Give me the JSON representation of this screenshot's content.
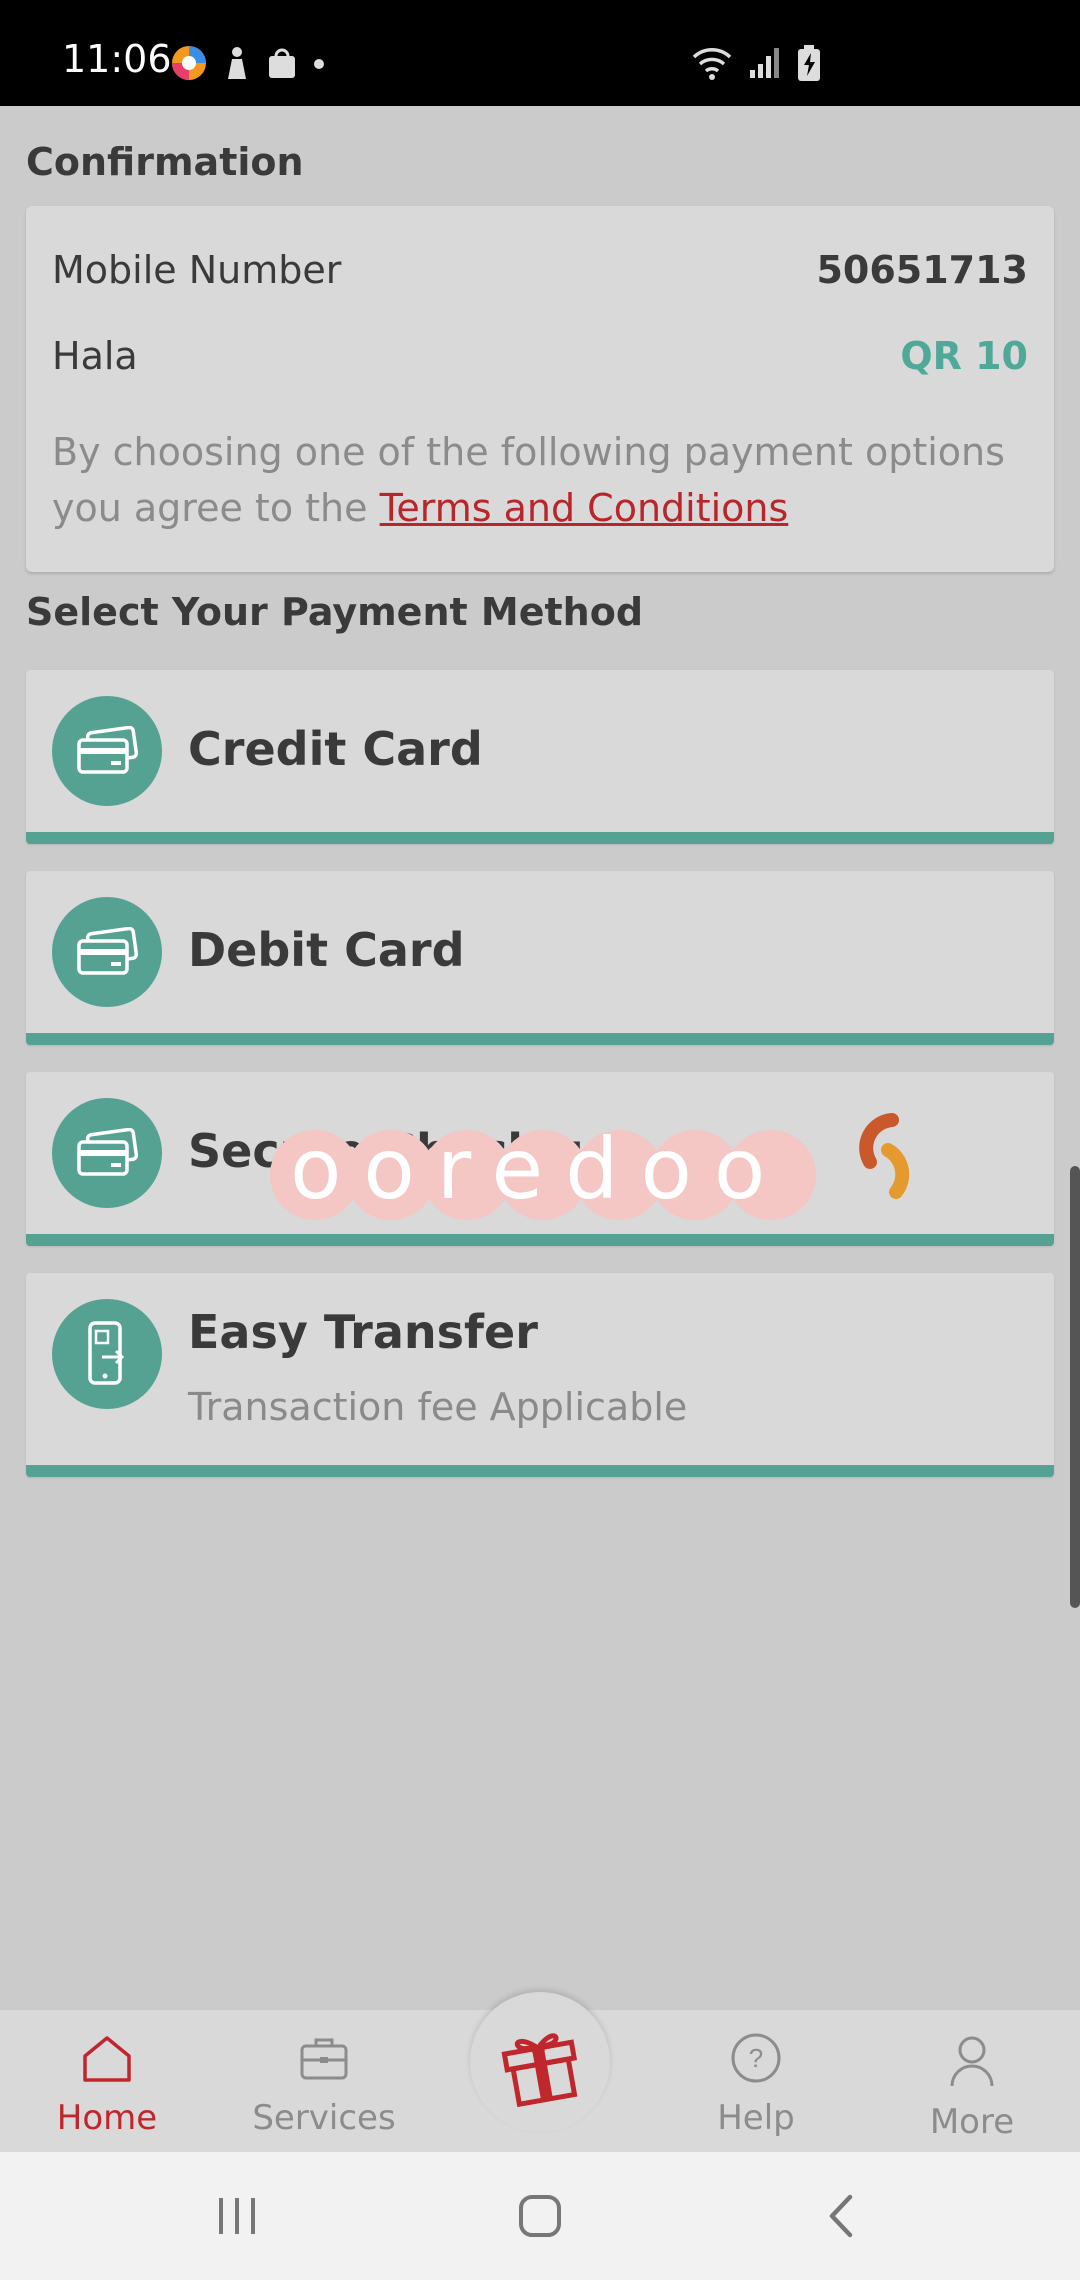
{
  "status_bar": {
    "time": "11:06",
    "icons_left": [
      "browser-icon",
      "app-icon",
      "shopping-bag-icon",
      "dot-icon"
    ],
    "icons_right": [
      "wifi-icon",
      "signal-icon",
      "battery-charging-icon"
    ]
  },
  "confirmation": {
    "title": "Confirmation",
    "mobile_label": "Mobile Number",
    "mobile_value": "50651713",
    "plan_label": "Hala",
    "plan_amount": "QR 10",
    "terms_prefix": "By choosing one of the following payment options you agree to the ",
    "terms_link": "Terms and Conditions"
  },
  "payment": {
    "title": "Select Your Payment Method",
    "methods": [
      {
        "label": "Credit Card",
        "icon": "credit-card-icon"
      },
      {
        "label": "Debit Card",
        "icon": "credit-card-icon"
      },
      {
        "label": "Secure Checkout",
        "icon": "credit-card-icon"
      },
      {
        "label": "Easy Transfer",
        "sub": "Transaction fee Applicable",
        "icon": "qr-transfer-icon"
      }
    ]
  },
  "loader": {
    "brand": "ooredoo"
  },
  "bottom_nav": {
    "items": [
      {
        "label": "Home",
        "icon": "home-icon",
        "active": true
      },
      {
        "label": "Services",
        "icon": "briefcase-icon"
      },
      {
        "label": "Help",
        "icon": "help-icon"
      },
      {
        "label": "More",
        "icon": "user-icon"
      }
    ],
    "center_icon": "gift-icon"
  },
  "system_nav": [
    "recents-icon",
    "home-circle-icon",
    "back-icon"
  ],
  "colors": {
    "accent": "#56a292",
    "brand_red": "#c0272d",
    "amount": "#4fa898",
    "link": "#b8262b"
  }
}
